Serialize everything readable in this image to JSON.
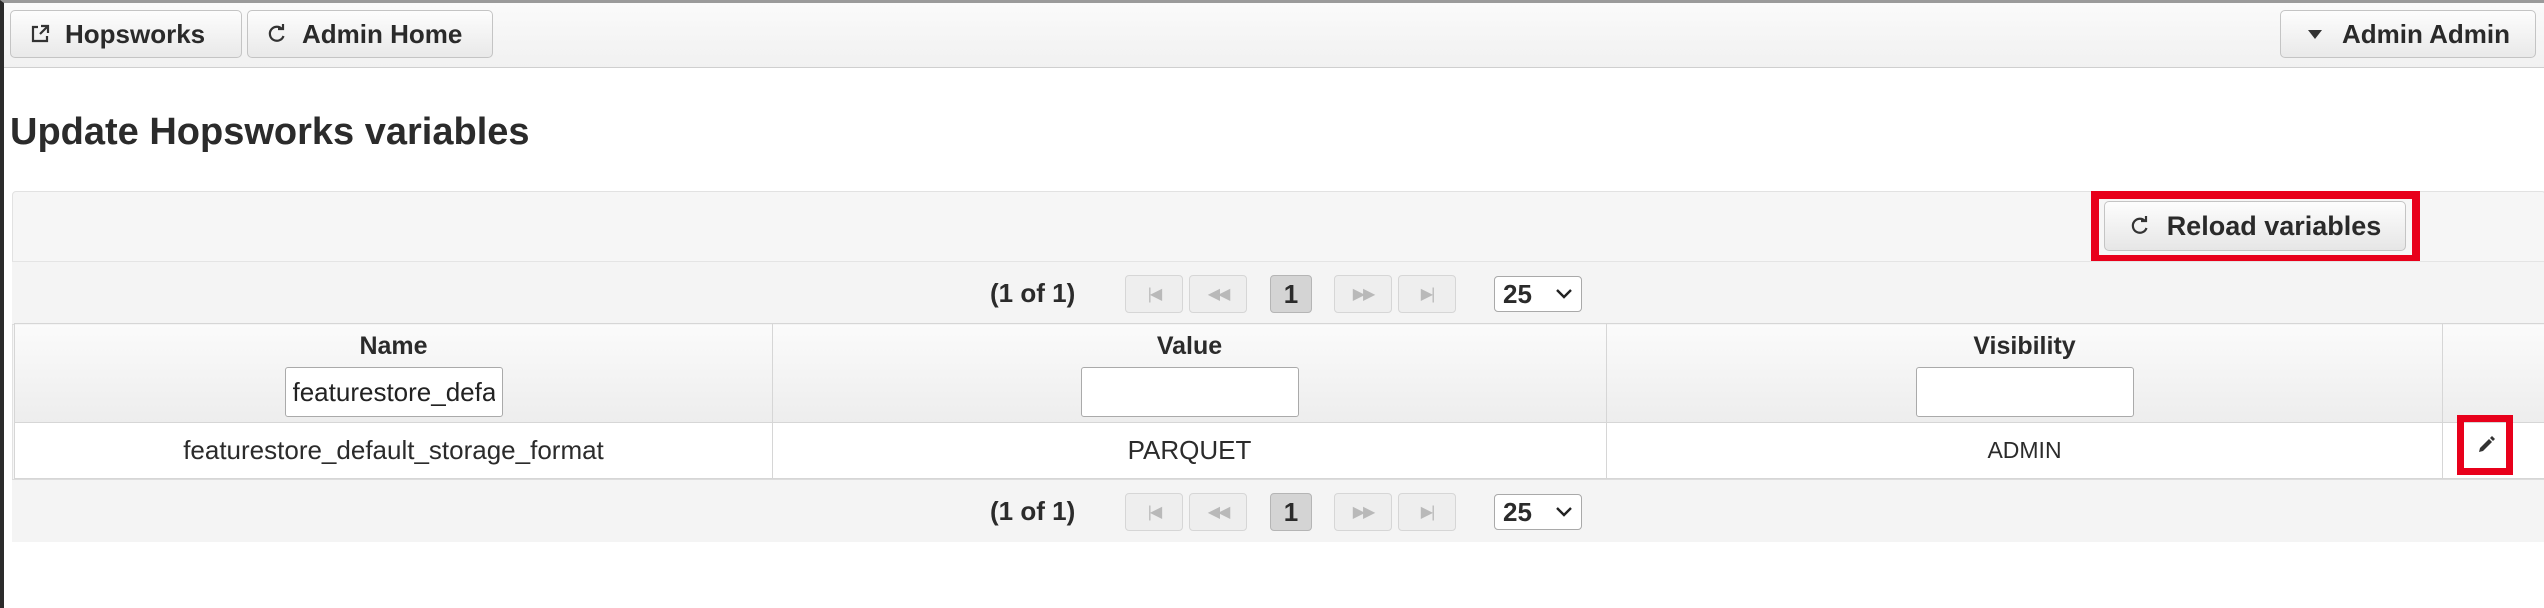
{
  "topbar": {
    "hopsworks_label": "Hopsworks",
    "admin_home_label": "Admin Home",
    "user_label": "Admin Admin"
  },
  "page": {
    "title": "Update Hopsworks variables"
  },
  "toolbar": {
    "reload_label": "Reload variables"
  },
  "pager": {
    "current": "(1 of 1)",
    "page": "1",
    "page_size": "25"
  },
  "table": {
    "columns": [
      {
        "label": "Name",
        "filter_value": "featurestore_default_storage_format"
      },
      {
        "label": "Value",
        "filter_value": ""
      },
      {
        "label": "Visibility",
        "filter_value": ""
      }
    ],
    "rows": [
      {
        "name": "featurestore_default_storage_format",
        "value": "PARQUET",
        "visibility": "ADMIN"
      }
    ]
  },
  "icons": {
    "hopsworks": "external-link-icon",
    "admin_home": "refresh-icon",
    "user": "caret-down-icon",
    "reload": "refresh-icon",
    "edit": "pencil-icon"
  },
  "colors": {
    "highlight": "#e8001b"
  }
}
